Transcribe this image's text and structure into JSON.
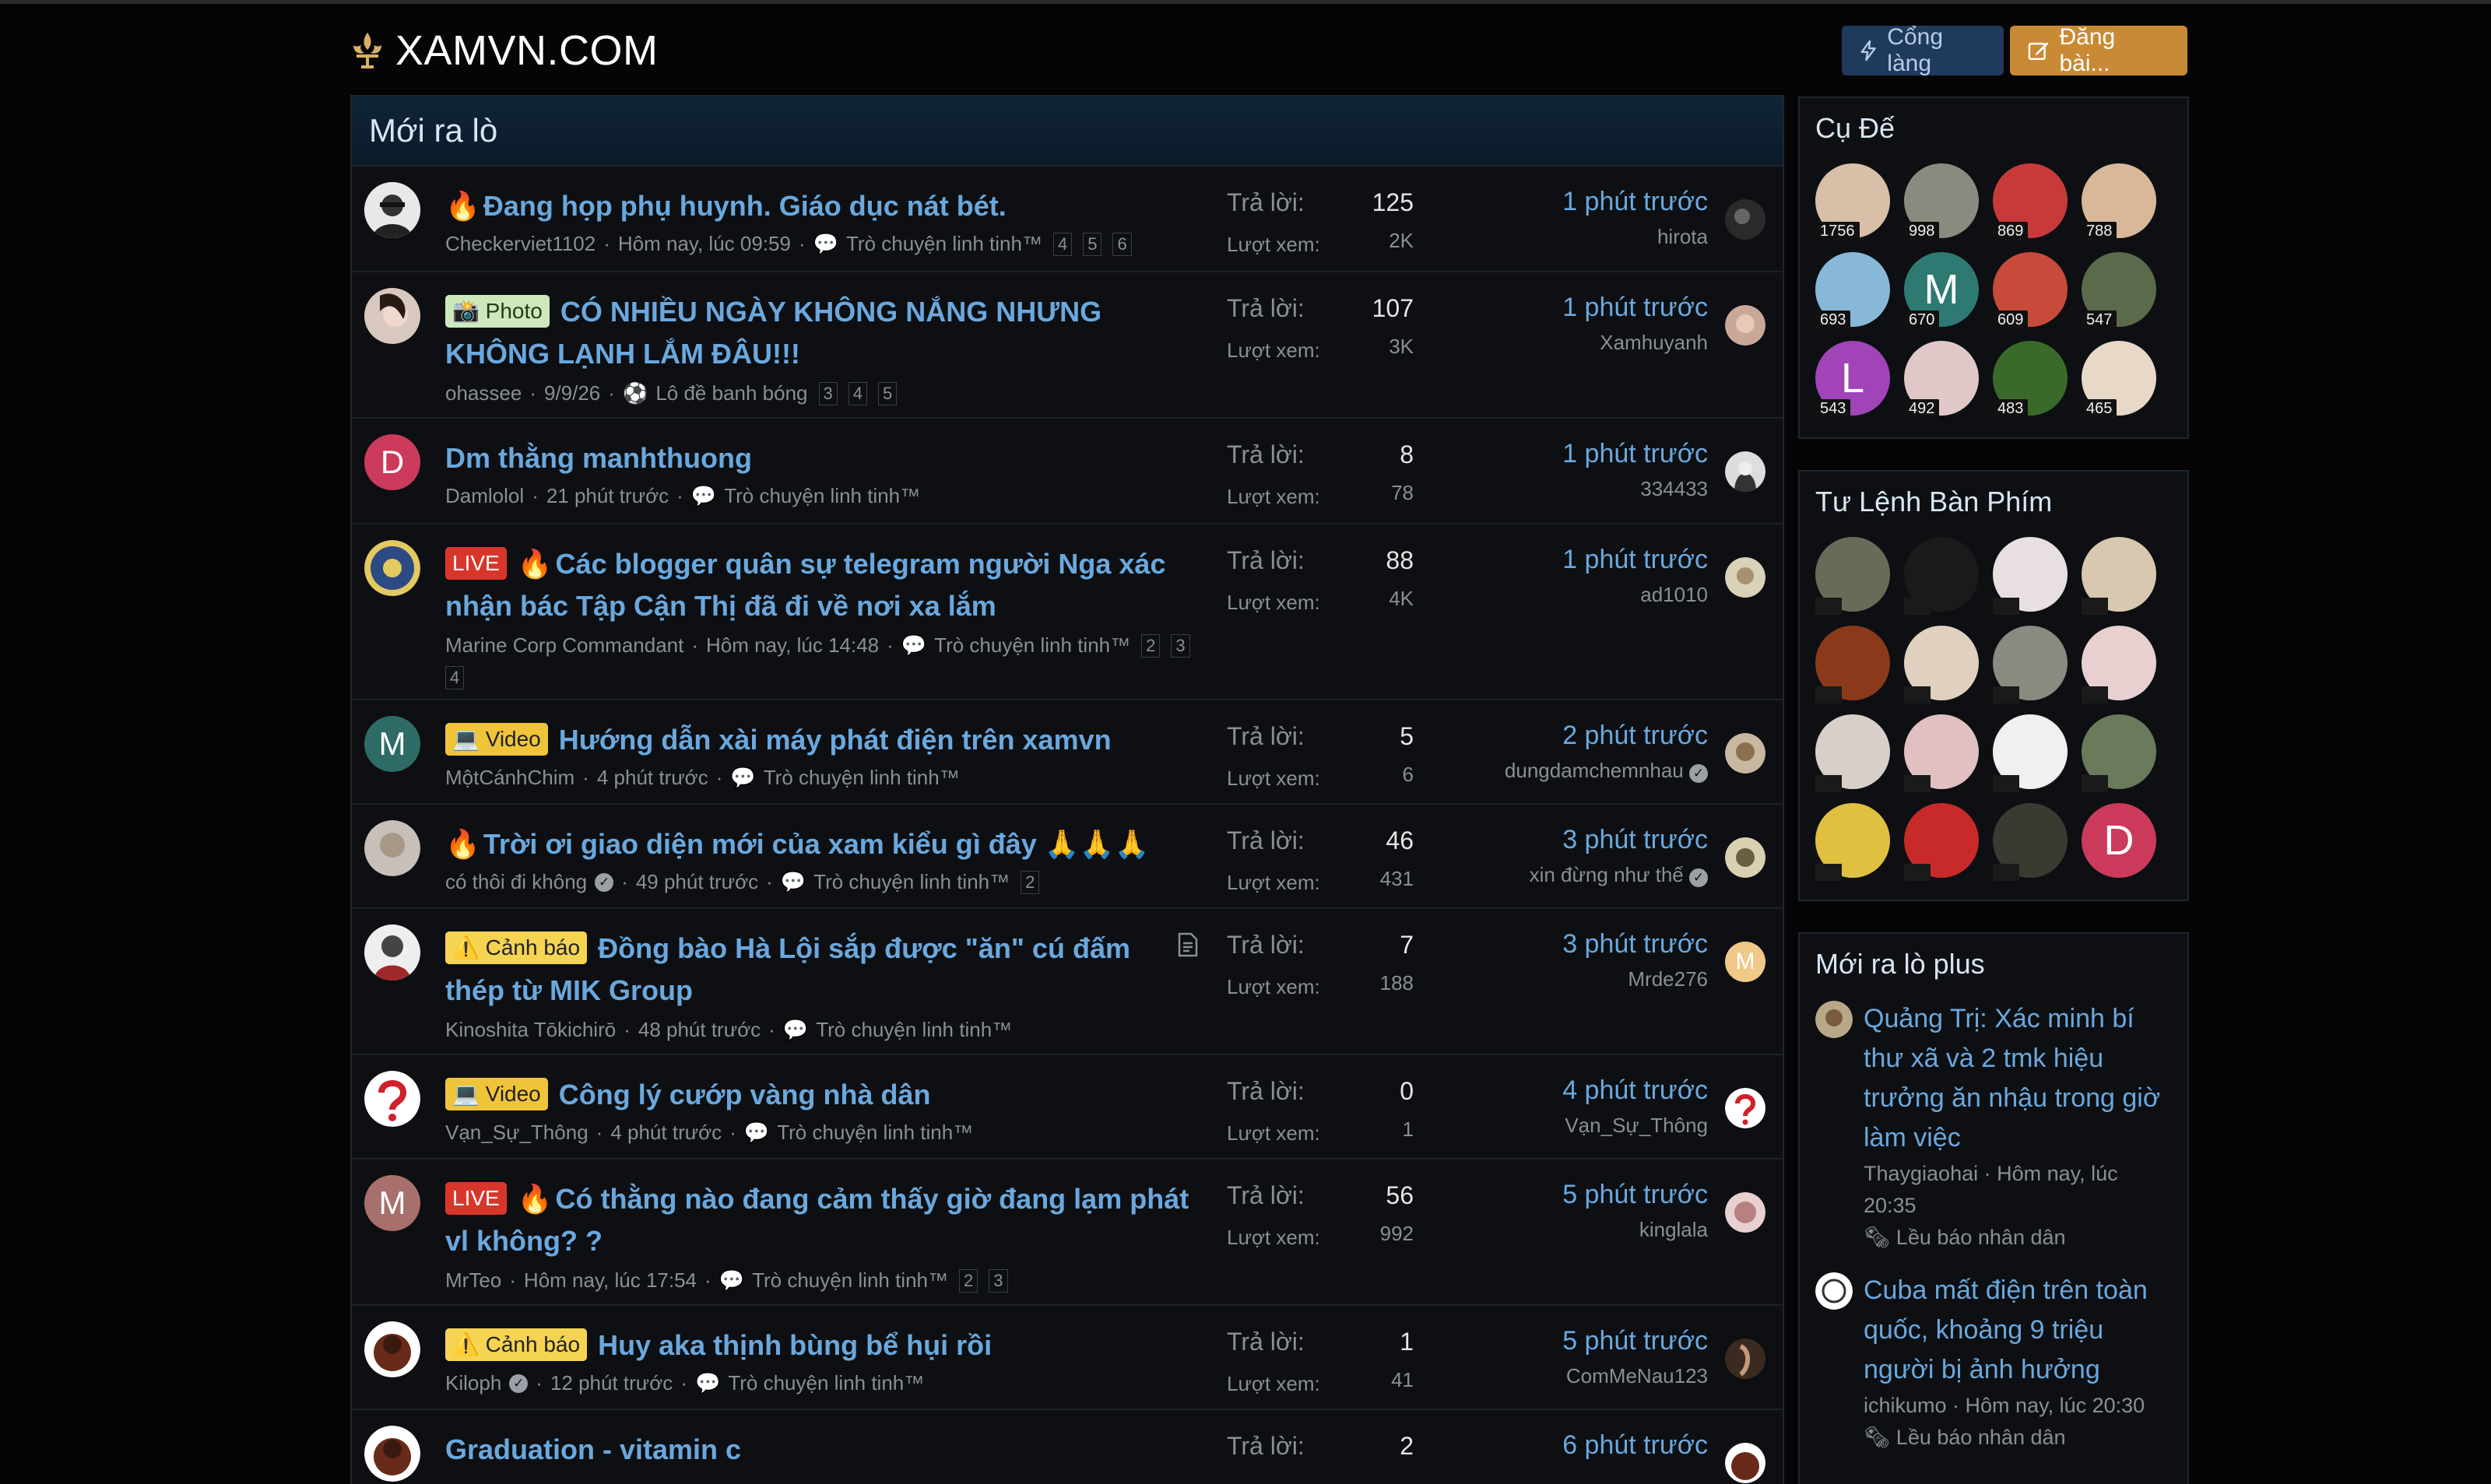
{
  "site": {
    "name": "XAMVN.COM"
  },
  "header": {
    "portal_label": "Cổng làng",
    "post_label": "Đăng bài..."
  },
  "main": {
    "title": "Mới ra lò",
    "replies_label": "Trả lời:",
    "views_label": "Lượt xem:",
    "threads": [
      {
        "title": "Đang họp phụ huynh. Giáo dục nát bét.",
        "author": "Checkerviet1102",
        "date": "Hôm nay, lúc 09:59",
        "forum": "Trò chuyện linh tinh™",
        "pages": [
          "4",
          "5",
          "6"
        ],
        "replies": "125",
        "views": "2K",
        "last_time": "1 phút trước",
        "last_user": "hirota"
      },
      {
        "label": "📸 Photo",
        "title_line1": "CÓ NHIỀU NGÀY KHÔNG NẮNG NHƯNG",
        "title_line2": "KHÔNG LẠNH LẮM ĐÂU!!!",
        "author": "ohassee",
        "date": "9/9/26",
        "forum": "Lô đề banh bóng",
        "pages": [
          "3",
          "4",
          "5"
        ],
        "replies": "107",
        "views": "3K",
        "last_time": "1 phút trước",
        "last_user": "Xamhuyanh"
      },
      {
        "title": "Dm thằng manhthuong",
        "author": "Damlolol",
        "date": "21 phút trước",
        "forum": "Trò chuyện linh tinh™",
        "replies": "8",
        "views": "78",
        "last_time": "1 phút trước",
        "last_user": "334433",
        "avatar_letter": "D"
      },
      {
        "label": "LIVE",
        "title_line1": "Các blogger quân sự telegram người Nga xác",
        "title_line2": "nhận bác Tập Cận Thị đã đi về nơi xa lắm",
        "author": "Marine Corp Commandant",
        "date": "Hôm nay, lúc 14:48",
        "forum": "Trò chuyện linh tinh™",
        "pages": [
          "2",
          "3",
          "4"
        ],
        "replies": "88",
        "views": "4K",
        "last_time": "1 phút trước",
        "last_user": "ad1010"
      },
      {
        "label": "💻 Video",
        "title": "Hướng dẫn xài máy phát điện trên xamvn",
        "author": "MộtCánhChim",
        "date": "4 phút trước",
        "forum": "Trò chuyện linh tinh™",
        "replies": "5",
        "views": "6",
        "last_time": "2 phút trước",
        "last_user": "dungdamchemnhau",
        "avatar_letter": "M"
      },
      {
        "title": "Trời ơi giao diện mới của xam kiểu gì đây 🙏🙏🙏",
        "author": "có thôi đi không",
        "date": "49 phút trước",
        "forum": "Trò chuyện linh tinh™",
        "pages": [
          "2"
        ],
        "replies": "46",
        "views": "431",
        "last_time": "3 phút trước",
        "last_user": "xin đừng như thế"
      },
      {
        "label": "⚠️ Cảnh báo",
        "title_line1": "Đồng bào Hà Lội sắp được \"ăn\" cú đấm",
        "title_line2": "thép từ MIK Group",
        "author": "Kinoshita Tōkichirō",
        "date": "48 phút trước",
        "forum": "Trò chuyện linh tinh™",
        "replies": "7",
        "views": "188",
        "last_time": "3 phút trước",
        "last_user": "Mrde276",
        "last_avatar_letter": "M"
      },
      {
        "label": "💻 Video",
        "title": "Công lý cướp vàng nhà dân",
        "author": "Vạn_Sự_Thông",
        "date": "4 phút trước",
        "forum": "Trò chuyện linh tinh™",
        "replies": "0",
        "views": "1",
        "last_time": "4 phút trước",
        "last_user": "Vạn_Sự_Thông"
      },
      {
        "label": "LIVE",
        "title_line1": "Có thằng nào đang cảm thấy giờ đang lạm phát",
        "title_line2": "vl không? ?",
        "author": "MrTeo",
        "date": "Hôm nay, lúc 17:54",
        "forum": "Trò chuyện linh tinh™",
        "pages": [
          "2",
          "3"
        ],
        "replies": "56",
        "views": "992",
        "last_time": "5 phút trước",
        "last_user": "kinglala",
        "avatar_letter": "M"
      },
      {
        "label": "⚠️ Cảnh báo",
        "title": "Huy aka thịnh bùng bể hụi rồi",
        "author": "Kiloph",
        "date": "12 phút trước",
        "forum": "Trò chuyện linh tinh™",
        "replies": "1",
        "views": "41",
        "last_time": "5 phút trước",
        "last_user": "ComMeNau123"
      },
      {
        "title": "Graduation - vitamin c",
        "replies": "2",
        "last_time": "6 phút trước"
      }
    ]
  },
  "sidebar": {
    "cu_de": {
      "title": "Cụ Đế",
      "counts": [
        "1756",
        "998",
        "869",
        "788",
        "693",
        "670",
        "609",
        "547",
        "543",
        "492",
        "483",
        "465"
      ],
      "letters": {
        "5": "M",
        "8": "L"
      }
    },
    "tu_lenh": {
      "title": "Tư Lệnh Bàn Phím",
      "letter_last": "D"
    },
    "news": {
      "title": "Mới ra lò plus",
      "items": [
        {
          "title_lines": [
            "Quảng Trị: Xác minh bí",
            "thư xã và 2 tmk hiệu",
            "trưởng ăn nhậu trong giờ",
            "làm việc"
          ],
          "author": "Thaygiaohai",
          "date_lines": [
            "Hôm nay, lúc",
            "20:35"
          ],
          "forum": "Lều báo nhân dân"
        },
        {
          "title_lines": [
            "Cuba mất điện trên toàn",
            "quốc, khoảng 9 triệu",
            "người bị ảnh hưởng"
          ],
          "author": "ichikumo",
          "date": "Hôm nay, lúc 20:30",
          "forum": "Lều báo nhân dân"
        }
      ]
    }
  },
  "colors": {
    "link": "#6aa8de",
    "post_button": "#c98a35",
    "portal_button": "#1f3a5c",
    "live": "#d9362b",
    "photo": "#cde8bb",
    "video": "#f0c43a"
  }
}
